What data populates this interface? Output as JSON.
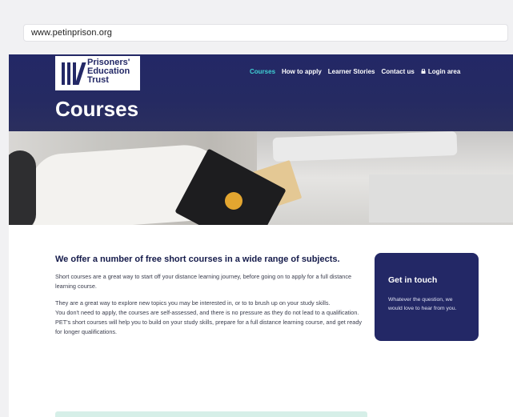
{
  "browser": {
    "url": "www.petinprison.org"
  },
  "header": {
    "logo_text": "Prisoners' Education Trust",
    "nav": [
      {
        "label": "Courses",
        "active": true
      },
      {
        "label": "How to apply",
        "active": false
      },
      {
        "label": "Learner Stories",
        "active": false
      },
      {
        "label": "Contact us",
        "active": false
      },
      {
        "label": "Login area",
        "active": false,
        "icon": "lock-icon"
      }
    ]
  },
  "hero": {
    "title": "Courses"
  },
  "main": {
    "headline": "We offer a number of free short courses in a wide range of subjects.",
    "paragraphs": [
      "Short courses are a great way to start off your distance learning journey, before going on to apply for a full distance learning course.",
      "They are a great way to explore new topics you may be interested in, or to to brush up on your study skills.",
      "You don't need to apply, the courses are self-assessed, and there is no pressure as they do not lead to a qualification.",
      "PET's short courses will help you to build on your study skills, prepare for a full distance learning course, and get ready for longer qualifications."
    ]
  },
  "sidebar_card": {
    "title": "Get in touch",
    "body": "Whatever the question, we would love to hear from you."
  },
  "colors": {
    "navy": "#232866",
    "accent_teal": "#3fd0d4",
    "mint_strip": "#d6efe8"
  }
}
